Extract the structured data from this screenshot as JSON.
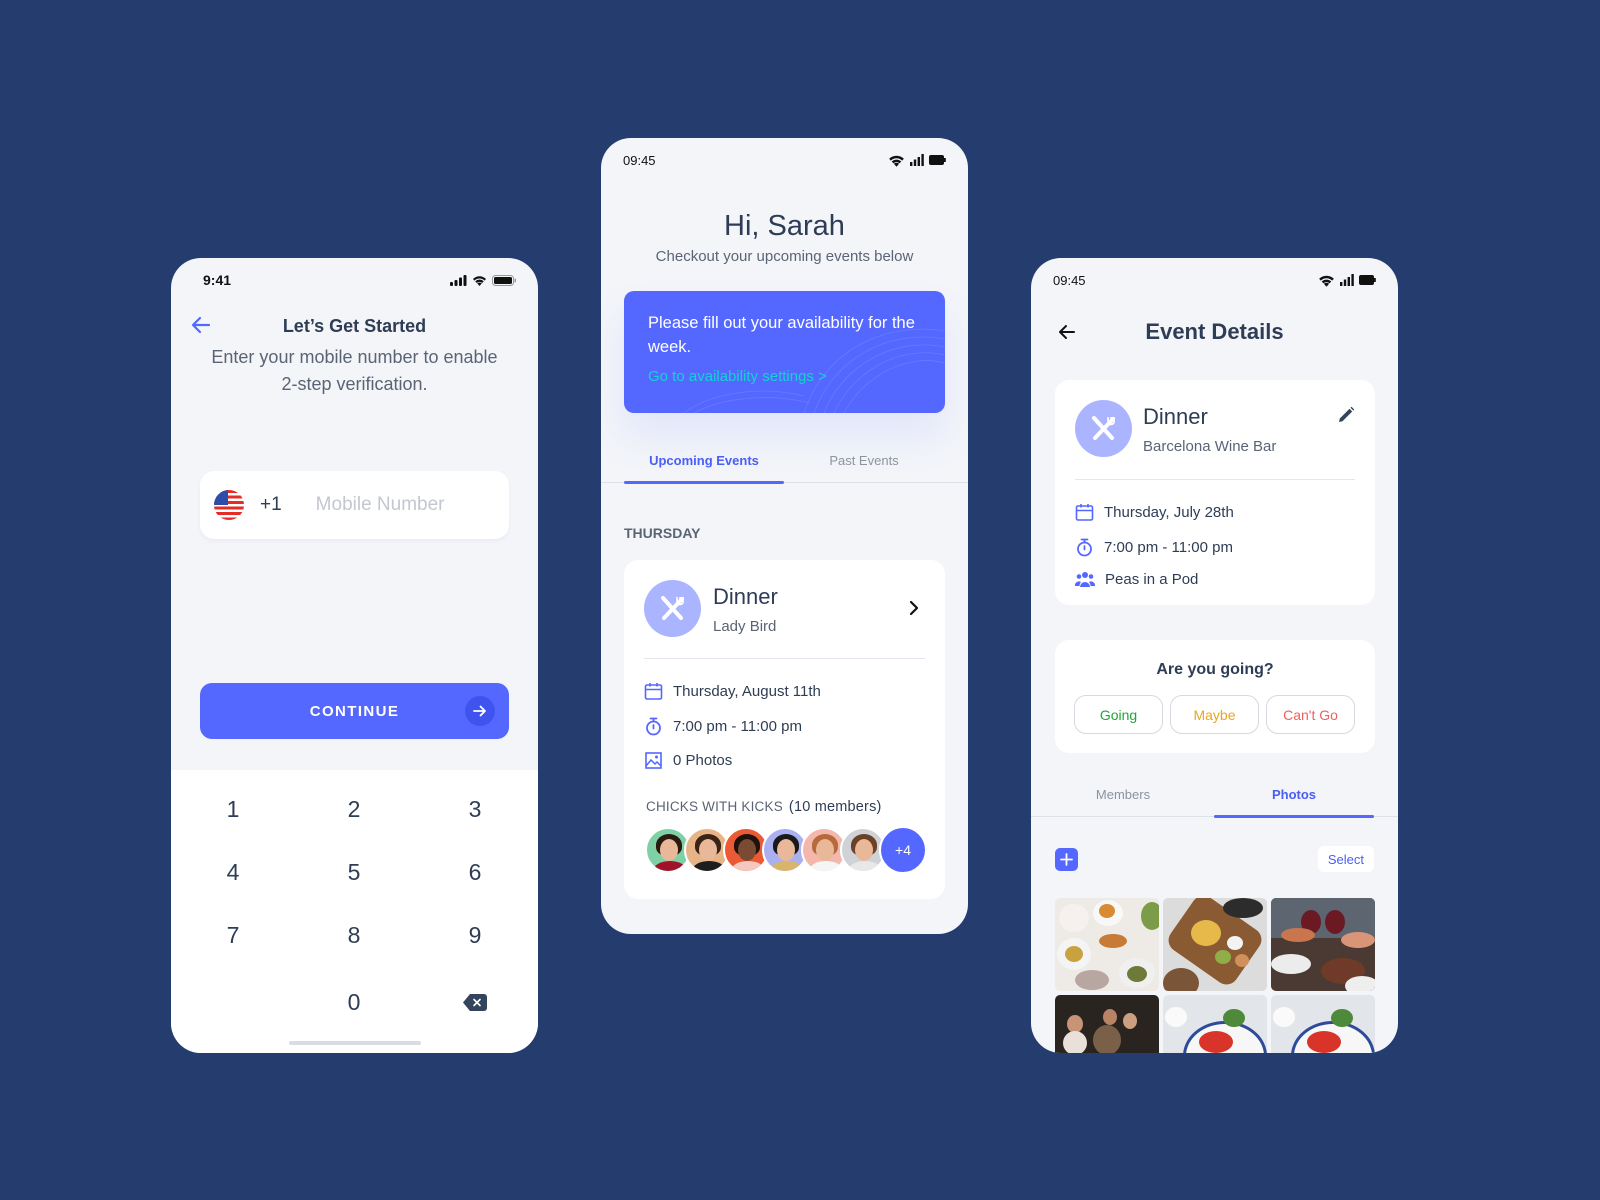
{
  "colors": {
    "background": "#243d6e",
    "accent": "#5468ff",
    "accent_light": "#aab4ff",
    "link_teal": "#12d3d4",
    "going": "#23a33a",
    "maybe": "#eaa61f",
    "cant_go": "#f0605d"
  },
  "login": {
    "status_time": "9:41",
    "title": "Let’s Get Started",
    "subtitle": "Enter your mobile number to enable 2-step verification.",
    "country_flag": "us-flag-icon",
    "dial_code": "+1",
    "mobile_value": "",
    "mobile_placeholder": "Mobile Number",
    "continue_label": "CONTINUE",
    "keypad": [
      "1",
      "2",
      "3",
      "4",
      "5",
      "6",
      "7",
      "8",
      "9",
      "",
      "0",
      "backspace"
    ]
  },
  "home": {
    "status_time": "09:45",
    "greeting": "Hi, Sarah",
    "subtitle": "Checkout your upcoming events below",
    "banner": {
      "text": "Please fill out your availability for the week.",
      "link": "Go to availability settings >"
    },
    "tabs": [
      {
        "label": "Upcoming Events",
        "active": true
      },
      {
        "label": "Past Events",
        "active": false
      }
    ],
    "day_label": "THURSDAY",
    "event": {
      "title": "Dinner",
      "venue": "Lady Bird",
      "date": "Thursday, August 11th",
      "time": "7:00 pm - 11:00 pm",
      "photos": "0 Photos",
      "group_name": "CHICKS WITH KICKS",
      "group_count": "(10 members)",
      "more_members": "+4"
    }
  },
  "event_details": {
    "status_time": "09:45",
    "title": "Event Details",
    "event": {
      "title": "Dinner",
      "venue": "Barcelona Wine Bar",
      "date": "Thursday, July 28th",
      "time": "7:00 pm - 11:00 pm",
      "group": "Peas in a Pod"
    },
    "rsvp": {
      "question": "Are you going?",
      "options": [
        "Going",
        "Maybe",
        "Can't Go"
      ]
    },
    "tabs": [
      {
        "label": "Members",
        "active": false
      },
      {
        "label": "Photos",
        "active": true
      }
    ],
    "select_label": "Select"
  }
}
